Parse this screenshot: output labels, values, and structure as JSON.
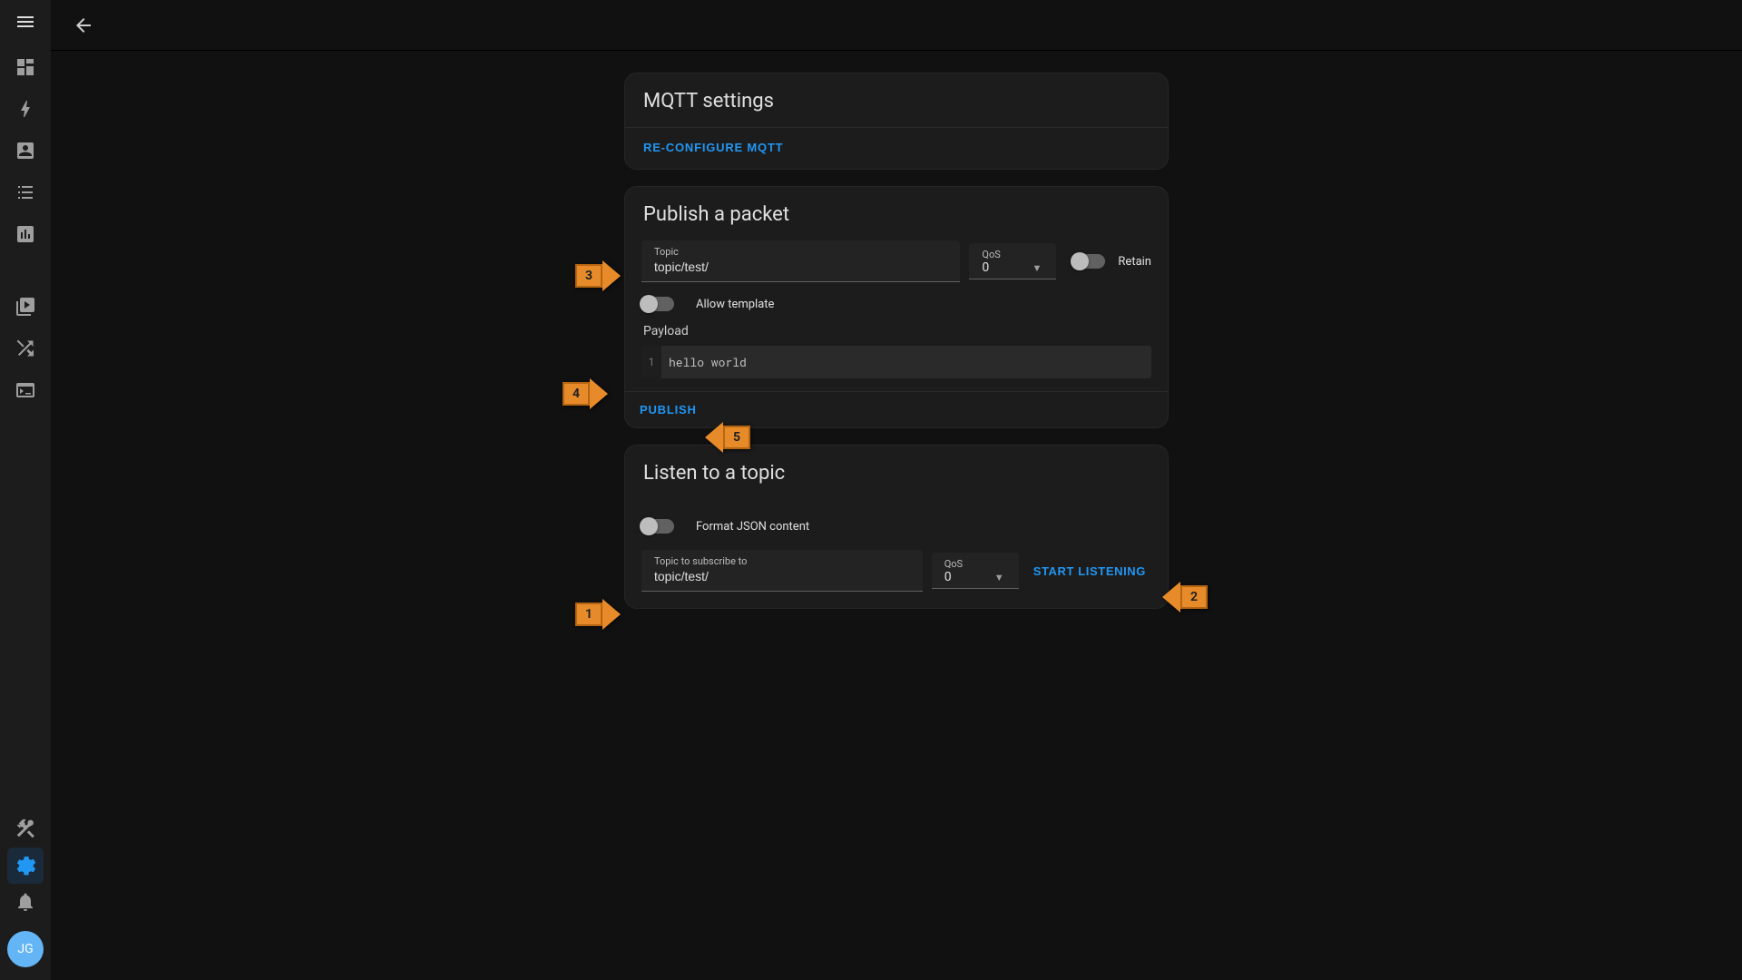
{
  "avatar": "JG",
  "cards": {
    "settings": {
      "title": "MQTT settings",
      "reconfigure": "RE-CONFIGURE MQTT"
    },
    "publish": {
      "title": "Publish a packet",
      "topic_label": "Topic",
      "topic_value": "topic/test/",
      "qos_label": "QoS",
      "qos_value": "0",
      "retain_label": "Retain",
      "allow_template_label": "Allow template",
      "payload_label": "Payload",
      "payload_line": "1",
      "payload_value": "hello world",
      "publish_btn": "PUBLISH"
    },
    "listen": {
      "title": "Listen to a topic",
      "format_json_label": "Format JSON content",
      "subscribe_label": "Topic to subscribe to",
      "subscribe_value": "topic/test/",
      "qos_label": "QoS",
      "qos_value": "0",
      "start_btn": "START LISTENING"
    }
  },
  "annotations": {
    "a1": "1",
    "a2": "2",
    "a3": "3",
    "a4": "4",
    "a5": "5"
  }
}
